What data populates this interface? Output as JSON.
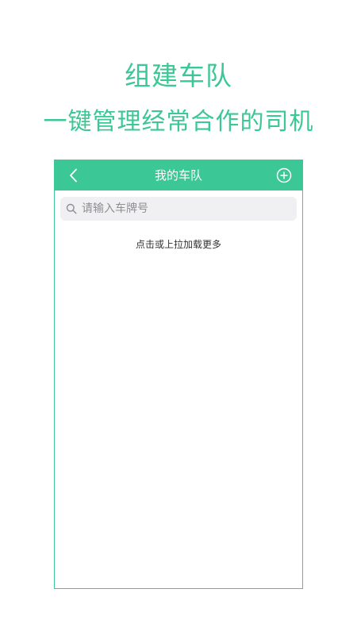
{
  "promo": {
    "title": "组建车队",
    "subtitle": "一键管理经常合作的司机"
  },
  "colors": {
    "accent": "#3cc796",
    "search_bg": "#f0f0f2",
    "placeholder": "#8e8e93"
  },
  "nav": {
    "title": "我的车队",
    "back_icon": "chevron-left-icon",
    "add_icon": "plus-circle-icon"
  },
  "search": {
    "icon": "search-icon",
    "value": "",
    "placeholder": "请输入车牌号"
  },
  "list": {
    "load_more_label": "点击或上拉加载更多"
  }
}
